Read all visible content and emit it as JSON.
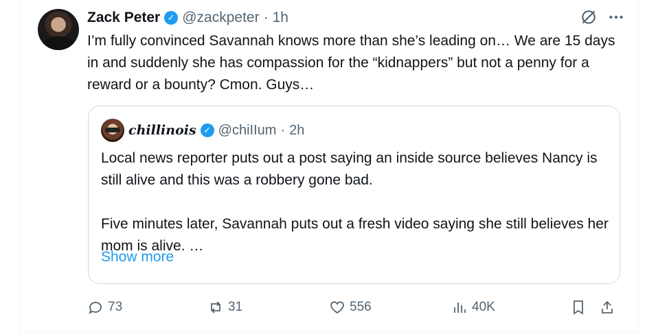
{
  "tweet": {
    "author_name": "Zack Peter",
    "handle": "@zackpeter",
    "separator": "·",
    "time": "1h",
    "text": "I’m fully convinced Savannah knows more than she’s leading on… We are 15 days in and suddenly she has compassion for the “kidnappers” but not a penny for a reward or a bounty? Cmon. Guys…",
    "more_icon": "more-dots-icon",
    "grok_icon": "grok-icon"
  },
  "quote": {
    "author_name": "chillinois",
    "handle": "@chiIIum",
    "separator": "·",
    "time": "2h",
    "paragraph1": "Local news reporter puts out a post saying an inside source believes Nancy is still alive and this was a robbery gone bad.",
    "paragraph2": "Five minutes later, Savannah puts out a fresh video saying she still believes her mom is alive. …",
    "show_more": "Show more"
  },
  "actions": {
    "replies": "73",
    "reposts": "31",
    "likes": "556",
    "views": "40K"
  },
  "colors": {
    "accent": "#1d9bf0",
    "muted": "#536471",
    "text": "#0f1419",
    "border": "#cfd9de"
  }
}
